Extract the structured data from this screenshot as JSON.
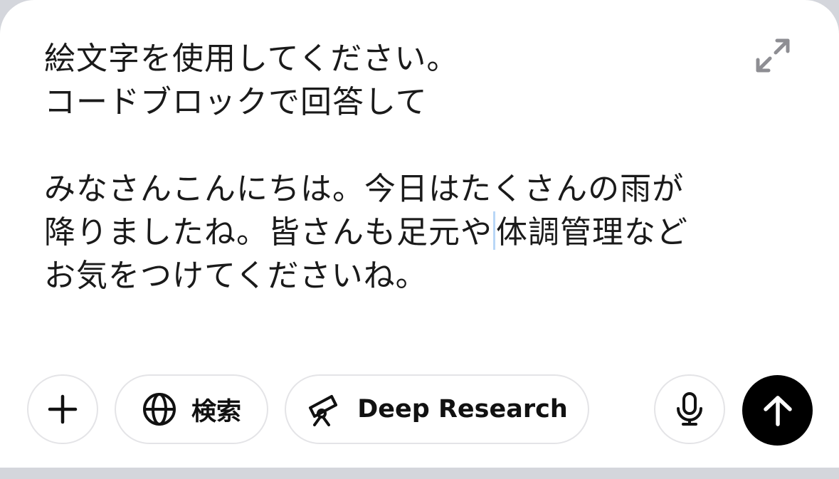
{
  "composer": {
    "lines": [
      "絵文字を使用してください。",
      "コードブロックで回答して",
      "",
      "みなさんこんにちは。今日はたくさんの雨が",
      "降りましたね。皆さんも足元や",
      "体調管理など",
      "お気をつけてくださいね。"
    ]
  },
  "toolbar": {
    "search_label": "検索",
    "research_label": "Deep Research"
  },
  "icons": {
    "expand": "expand-arrows-icon",
    "plus": "plus-icon",
    "search": "globe-icon",
    "research": "telescope-icon",
    "mic": "microphone-icon",
    "send": "arrow-up-icon"
  },
  "colors": {
    "text": "#1a1a1a",
    "send_background": "#000000",
    "caret": "#b9d7f7",
    "pill_border": "#e4e4e7",
    "expand_icon": "#8e8e93"
  }
}
